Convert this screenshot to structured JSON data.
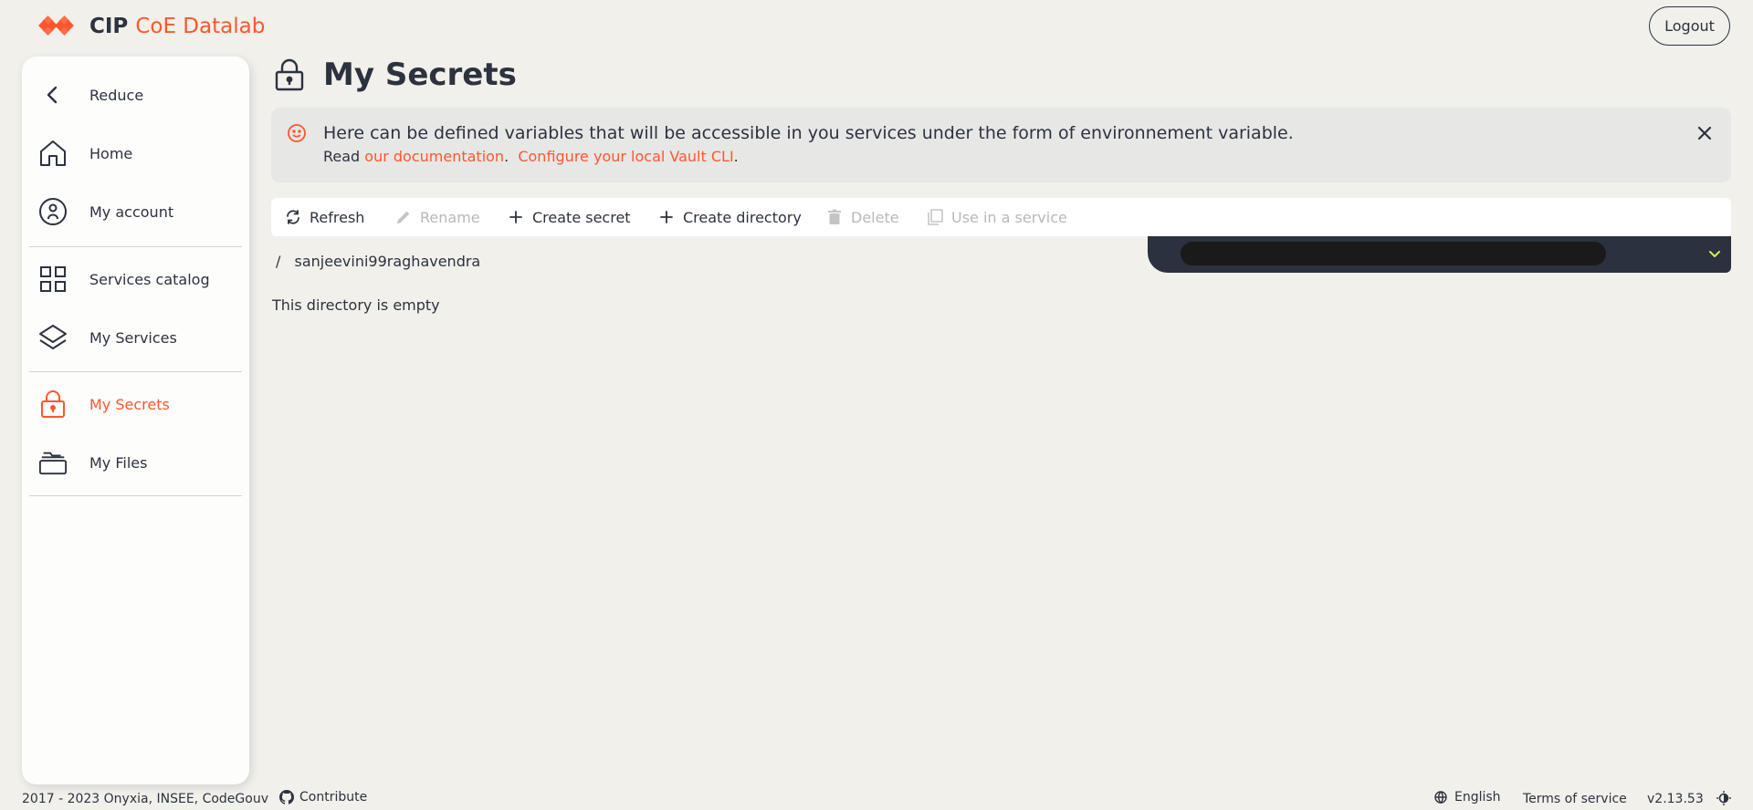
{
  "app": {
    "brand_primary": "CIP",
    "brand_secondary": "CoE Datalab",
    "accent_color": "#ff562c",
    "logout_label": "Logout"
  },
  "sidebar": {
    "items": [
      {
        "label": "Reduce",
        "icon": "chevron-left-icon"
      },
      {
        "label": "Home",
        "icon": "home-icon"
      },
      {
        "label": "My account",
        "icon": "account-icon"
      },
      {
        "label": "Services catalog",
        "icon": "grid-icon"
      },
      {
        "label": "My Services",
        "icon": "layers-icon"
      },
      {
        "label": "My Secrets",
        "icon": "lock-icon",
        "active": true
      },
      {
        "label": "My Files",
        "icon": "folders-icon"
      }
    ]
  },
  "page": {
    "title": "My Secrets",
    "title_icon": "lock-icon"
  },
  "alert": {
    "icon": "smiley-icon",
    "message": "Here can be defined variables that will be accessible in you services under the form of environnement variable.",
    "read_prefix": "Read",
    "doc_link": "our documentation",
    "vault_link": "Configure your local Vault CLI",
    "close_icon": "close-icon"
  },
  "toolbar": {
    "refresh": "Refresh",
    "rename": "Rename",
    "create_secret": "Create secret",
    "create_directory": "Create directory",
    "delete": "Delete",
    "use_in_service": "Use in a service"
  },
  "explorer": {
    "breadcrumb_separator": "/",
    "current_path": "sanjeevini99raghavendra",
    "empty_message": "This directory is empty"
  },
  "footer": {
    "copyright": "2017 - 2023 Onyxia, INSEE, CodeGouv",
    "contribute": "Contribute",
    "language": "English",
    "terms": "Terms of service",
    "version": "v2.13.53"
  }
}
